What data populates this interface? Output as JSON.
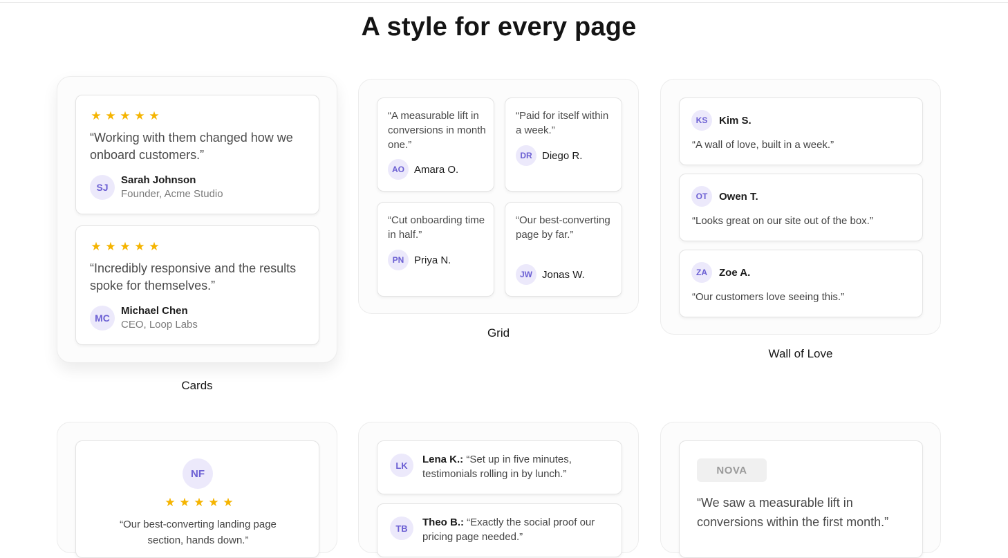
{
  "page": {
    "title": "A style for every page"
  },
  "colors": {
    "star": "#f5b400",
    "avatar_bg": "#ece9fb",
    "avatar_text": "#6b5fd3"
  },
  "icons": {
    "star": "star-icon"
  },
  "cards_style": {
    "label": "Cards",
    "items": [
      {
        "stars": 5,
        "quote": "“Working with them changed how we onboard customers.”",
        "initials": "SJ",
        "name": "Sarah Johnson",
        "role": "Founder, Acme Studio"
      },
      {
        "stars": 5,
        "quote": "“Incredibly responsive and the results spoke for themselves.”",
        "initials": "MC",
        "name": "Michael Chen",
        "role": "CEO, Loop Labs"
      }
    ]
  },
  "grid_style": {
    "label": "Grid",
    "items": [
      {
        "quote": "“A measurable lift in conversions in month one.”",
        "initials": "AO",
        "name": "Amara O."
      },
      {
        "quote": "“Paid for itself within a week.”",
        "initials": "DR",
        "name": "Diego R."
      },
      {
        "quote": "“Cut onboarding time in half.”",
        "initials": "PN",
        "name": "Priya N."
      },
      {
        "quote": "“Our best-converting page by far.”",
        "initials": "JW",
        "name": "Jonas W."
      }
    ]
  },
  "wall_style": {
    "label": "Wall of Love",
    "items": [
      {
        "initials": "KS",
        "name": "Kim S.",
        "quote": "“A wall of love, built in a week.”"
      },
      {
        "initials": "OT",
        "name": "Owen T.",
        "quote": "“Looks great on our site out of the box.”"
      },
      {
        "initials": "ZA",
        "name": "Zoe A.",
        "quote": "“Our customers love seeing this.”"
      }
    ]
  },
  "spotlight_style": {
    "initials": "NF",
    "stars": 5,
    "quote": "“Our best-converting landing page section, hands down.”"
  },
  "list_style": {
    "items": [
      {
        "initials": "LK",
        "name": "Lena K.:",
        "quote": "“Set up in five minutes, testimonials rolling in by lunch.”"
      },
      {
        "initials": "TB",
        "name": "Theo B.:",
        "quote": "“Exactly the social proof our pricing page needed.”"
      }
    ]
  },
  "logo_style": {
    "logo": "NOVA",
    "quote": "“We saw a measurable lift in conversions within the first month.”"
  }
}
